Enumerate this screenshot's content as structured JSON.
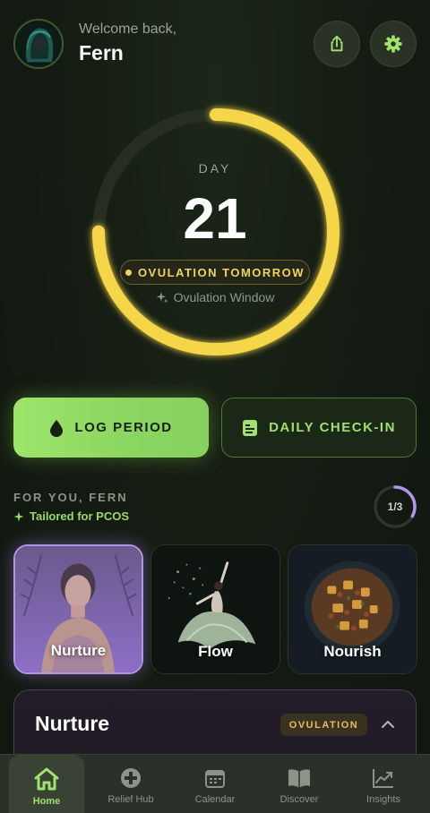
{
  "header": {
    "welcome": "Welcome back,",
    "username": "Fern"
  },
  "cycle": {
    "day_label": "DAY",
    "day": "21",
    "status": "OVULATION TOMORROW",
    "window": "Ovulation Window",
    "ring_progress": 0.75,
    "ring_color": "#f5d64a"
  },
  "actions": {
    "log_period": "LOG PERIOD",
    "daily_checkin": "DAILY CHECK-IN"
  },
  "for_you": {
    "heading": "FOR YOU, FERN",
    "tailored": "Tailored for PCOS",
    "progress_text": "1/3",
    "progress_value": 0.33,
    "cards": [
      {
        "label": "Nurture"
      },
      {
        "label": "Flow"
      },
      {
        "label": "Nourish"
      }
    ]
  },
  "panel": {
    "title": "Nurture",
    "badge": "OVULATION"
  },
  "tabs": [
    {
      "label": "Home"
    },
    {
      "label": "Relief Hub"
    },
    {
      "label": "Calendar"
    },
    {
      "label": "Discover"
    },
    {
      "label": "Insights"
    }
  ],
  "colors": {
    "accent_green": "#9de46a",
    "accent_yellow": "#f5d64a",
    "accent_purple": "#b195e6"
  }
}
